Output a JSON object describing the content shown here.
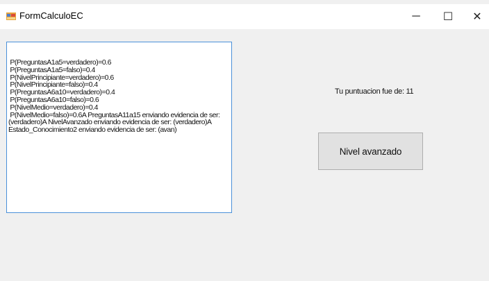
{
  "window": {
    "title": "FormCalculoEC",
    "controls": {
      "minimize": "─",
      "maximize": "☐",
      "close": "✕"
    }
  },
  "results_text": " P(PreguntasA1a5=verdadero)=0.6\n P(PreguntasA1a5=falso)=0.4\n P(NivelPrincipiante=verdadero)=0.6\n P(NivelPrincipiante=falso)=0.4\n P(PreguntasA6a10=verdadero)=0.4\n P(PreguntasA6a10=falso)=0.6\n P(NivelMedio=verdadero)=0.4\n P(NivelMedio=falso)=0.6A PreguntasA11a15 enviando evidencia de ser: (verdadero)A NivelAvanzado enviando evidencia de ser: (verdadero)A Estado_Conocimiento2 enviando evidencia de ser: (avan)",
  "score_label": "Tu puntuacion fue de: 11",
  "level_button": "Nivel avanzado"
}
